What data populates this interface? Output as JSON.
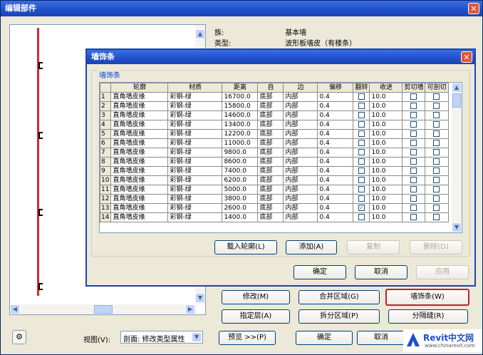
{
  "main": {
    "title": "编辑部件",
    "close": "✕",
    "props": [
      {
        "label": "族:",
        "value": "基本墙"
      },
      {
        "label": "类型:",
        "value": "波形板墙皮（有楼条）"
      }
    ],
    "buttons": {
      "modify": "修改(M)",
      "merge": "合并区域(G)",
      "sweeps": "墙饰条(W)",
      "assign": "指定层(A)",
      "split": "拆分区域(P)",
      "reveals": "分隔缝(R)",
      "preview": "预览 >>(P)",
      "ok": "确定",
      "cancel": "取消"
    },
    "view_label": "视图(V):",
    "view_value": "剖面: 修改类型属性",
    "help_icon": "help-icon"
  },
  "dialog": {
    "title": "墙饰条",
    "close": "✕",
    "group_label": "墙饰条",
    "headers": [
      "",
      "轮廓",
      "材质",
      "距离",
      "自",
      "边",
      "偏移",
      "翻转",
      "收进",
      "剪切墙",
      "可剖切"
    ],
    "rows": [
      {
        "n": "1",
        "profile": "直角墙皮缘",
        "material": "彩钢-绿",
        "distance": "16700.0",
        "from": "底部",
        "side": "内部",
        "offset": "0.4",
        "flip": false,
        "setback": "10.0"
      },
      {
        "n": "2",
        "profile": "直角墙皮缘",
        "material": "彩钢-绿",
        "distance": "15800.0",
        "from": "底部",
        "side": "内部",
        "offset": "0.4",
        "flip": false,
        "setback": "10.0"
      },
      {
        "n": "3",
        "profile": "直角墙皮缘",
        "material": "彩钢-绿",
        "distance": "14600.0",
        "from": "底部",
        "side": "内部",
        "offset": "0.4",
        "flip": false,
        "setback": "10.0"
      },
      {
        "n": "4",
        "profile": "直角墙皮缘",
        "material": "彩钢-绿",
        "distance": "13400.0",
        "from": "底部",
        "side": "内部",
        "offset": "0.4",
        "flip": false,
        "setback": "10.0"
      },
      {
        "n": "5",
        "profile": "直角墙皮缘",
        "material": "彩钢-绿",
        "distance": "12200.0",
        "from": "底部",
        "side": "内部",
        "offset": "0.4",
        "flip": false,
        "setback": "10.0"
      },
      {
        "n": "6",
        "profile": "直角墙皮缘",
        "material": "彩钢-绿",
        "distance": "11000.0",
        "from": "底部",
        "side": "内部",
        "offset": "0.4",
        "flip": false,
        "setback": "10.0"
      },
      {
        "n": "7",
        "profile": "直角墙皮缘",
        "material": "彩钢-绿",
        "distance": "9800.0",
        "from": "底部",
        "side": "内部",
        "offset": "0.4",
        "flip": false,
        "setback": "10.0"
      },
      {
        "n": "8",
        "profile": "直角墙皮缘",
        "material": "彩钢-绿",
        "distance": "8600.0",
        "from": "底部",
        "side": "内部",
        "offset": "0.4",
        "flip": false,
        "setback": "10.0"
      },
      {
        "n": "9",
        "profile": "直角墙皮缘",
        "material": "彩钢-绿",
        "distance": "7400.0",
        "from": "底部",
        "side": "内部",
        "offset": "0.4",
        "flip": false,
        "setback": "10.0"
      },
      {
        "n": "10",
        "profile": "直角墙皮缘",
        "material": "彩钢-绿",
        "distance": "6200.0",
        "from": "底部",
        "side": "内部",
        "offset": "0.4",
        "flip": false,
        "setback": "10.0"
      },
      {
        "n": "11",
        "profile": "直角墙皮缘",
        "material": "彩钢-绿",
        "distance": "5000.0",
        "from": "底部",
        "side": "内部",
        "offset": "0.4",
        "flip": false,
        "setback": "10.0"
      },
      {
        "n": "12",
        "profile": "直角墙皮缘",
        "material": "彩钢-绿",
        "distance": "3800.0",
        "from": "底部",
        "side": "内部",
        "offset": "0.4",
        "flip": false,
        "setback": "10.0"
      },
      {
        "n": "13",
        "profile": "直角墙皮缘",
        "material": "彩钢-绿",
        "distance": "2600.0",
        "from": "底部",
        "side": "内部",
        "offset": "0.4",
        "flip": true,
        "setback": "10.0"
      },
      {
        "n": "14",
        "profile": "直角墙皮缘",
        "material": "彩钢-绿",
        "distance": "1400.0",
        "from": "底部",
        "side": "内部",
        "offset": "0.4",
        "flip": false,
        "setback": "10.0"
      }
    ],
    "buttons": {
      "load_profile": "载入轮廓(L)",
      "add": "添加(A)",
      "duplicate": "复制",
      "delete": "删除(D)",
      "ok": "确定",
      "cancel": "取消",
      "apply": "应用"
    }
  },
  "watermark": {
    "brand": "Revit中文网",
    "url": "www.chinarevit.com"
  },
  "colors": {
    "title_blue": "#1f4fc9",
    "wall_red": "#e0262d",
    "highlight_red": "#c21f3a"
  }
}
